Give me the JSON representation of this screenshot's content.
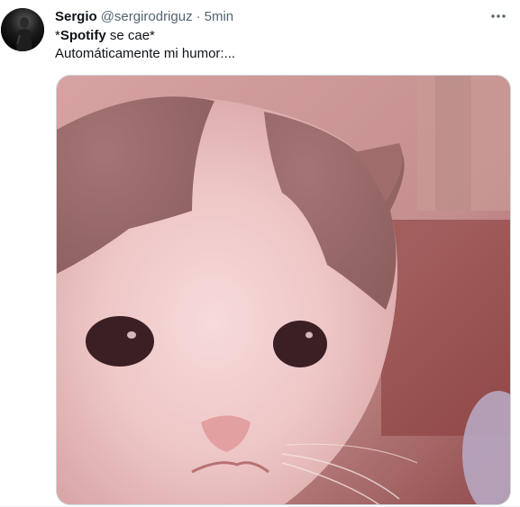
{
  "tweet": {
    "author_name": "Sergio",
    "author_handle": "@sergirodriguz",
    "separator": "·",
    "time": "5min",
    "line1_bold": "Spotify",
    "line1_prefix": "*",
    "line1_suffix": " se cae*",
    "line2": "Automáticamente mi humor:..."
  },
  "icons": {
    "more": "more-horizontal-icon",
    "avatar": "user-avatar",
    "media": "kitten-photo"
  },
  "colors": {
    "text_primary": "#0f1419",
    "text_secondary": "#536471",
    "border": "#cfd9de"
  }
}
